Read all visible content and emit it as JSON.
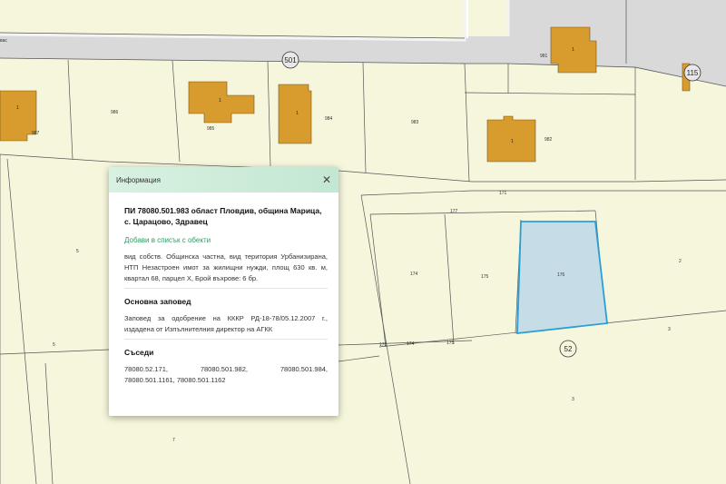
{
  "map": {
    "parcels": {
      "p986": "986",
      "p985": "985",
      "p984": "984",
      "p983": "983",
      "p982": "982",
      "p987": "987",
      "p981": "981",
      "p171": "171",
      "p177": "177",
      "p174": "174",
      "p175": "175",
      "p176": "176",
      "p173": "173",
      "p174b": "174",
      "p175b": "175",
      "p2": "2",
      "p3": "3",
      "p3b": "3",
      "p5": "5",
      "p5b": "5",
      "p7": "7"
    },
    "buildings": {
      "b1": "1",
      "b2": "1",
      "b3": "1",
      "b4": "1",
      "b5": "1",
      "b6": "1"
    },
    "streets": {
      "s501": "501",
      "s115": "115",
      "s52": "52",
      "sfrag": "вас"
    },
    "colors": {
      "background": "#f6f6dc",
      "road": "#d9d9d9",
      "building": "#d79b2e",
      "selected_fill": "#c6dde8",
      "selected_stroke": "#2a9fd6"
    }
  },
  "popup": {
    "title": "Информация",
    "close_icon": "close-icon",
    "heading": "ПИ 78080.501.983 област Пловдив, община Марица, с. Царацово, Здравец",
    "add_link": "Добави в списък с обекти",
    "description": "вид собств. Общинска частна, вид територия Урбанизирана, НТП Незастроен имот за жилищни нужди, площ 630 кв. м, квартал 68, парцел X, Брой въхрове: 6 бр.",
    "section_order_title": "Основна заповед",
    "order_text": "Заповед за одобрение на КККР РД-18-78/05.12.2007 г., издадена от Изпълнителния директор на АГКК",
    "section_neighbors_title": "Съседи",
    "neighbors": {
      "n1": "78080.52.171,",
      "n2": "78080.501.982,",
      "n3": "78080.501.984,",
      "line2": "78080.501.1161, 78080.501.1162"
    }
  }
}
